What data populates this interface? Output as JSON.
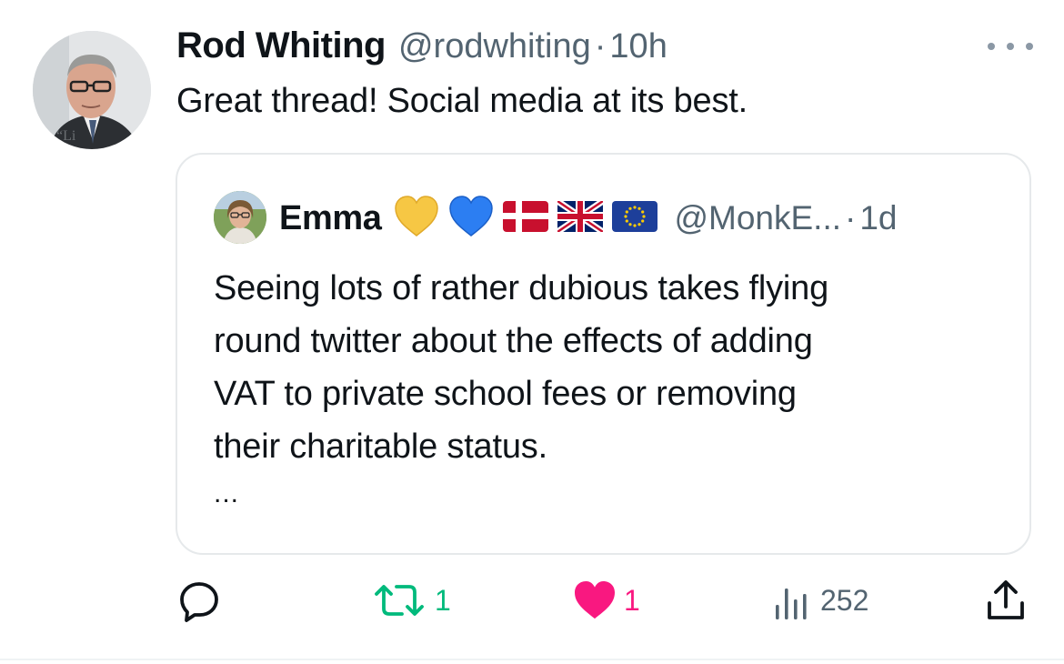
{
  "tweet": {
    "author_name": "Rod Whiting",
    "handle": "@rodwhiting",
    "separator": "·",
    "time": "10h",
    "text": "Great thread! Social media at its best."
  },
  "quoted_tweet": {
    "author_name": "Emma",
    "name_emojis": [
      "yellow-heart",
      "blue-heart",
      "denmark-flag",
      "uk-flag",
      "eu-flag"
    ],
    "handle": "@MonkE...",
    "separator": "·",
    "time": "1d",
    "text_lines": [
      "Seeing lots of rather dubious takes flying",
      "round twitter about the effects of adding",
      "VAT to private school fees or removing",
      "their charitable status."
    ],
    "ellipsis": "..."
  },
  "actions": {
    "replies": "",
    "retweets": "1",
    "likes": "1",
    "views": "252"
  },
  "colors": {
    "text": "#0f1419",
    "secondary": "#536471",
    "retweet": "#00ba7c",
    "like": "#f91880",
    "border": "#e6e9eb"
  }
}
